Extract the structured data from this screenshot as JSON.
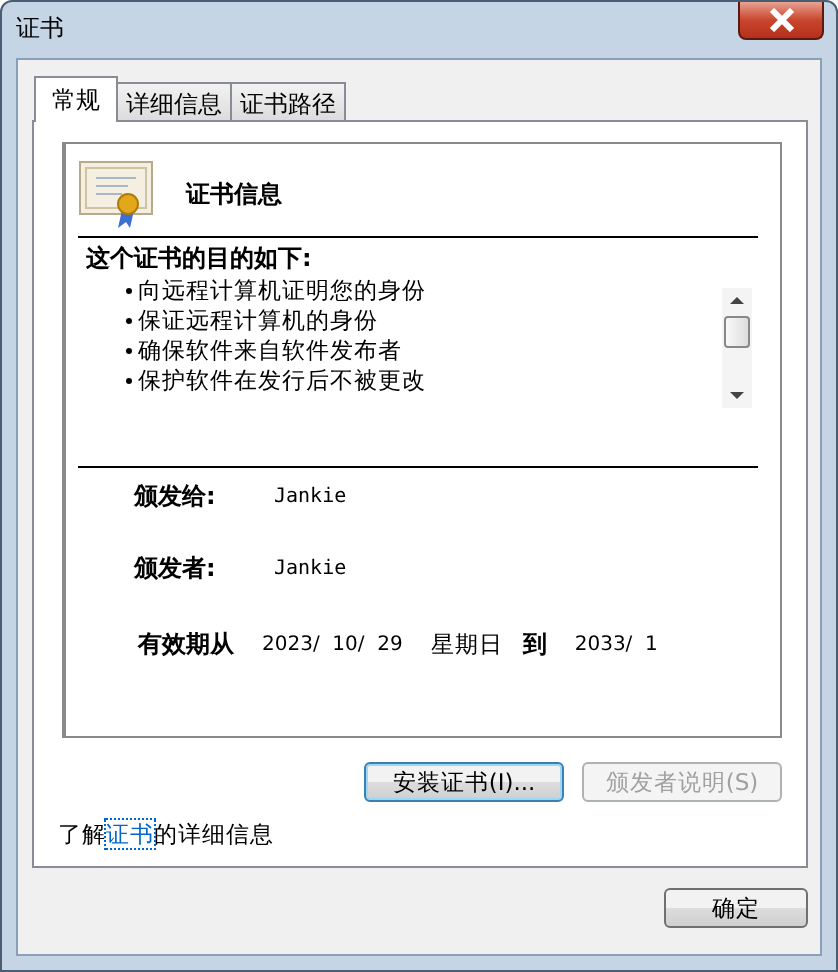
{
  "window": {
    "title": "证书"
  },
  "tabs": [
    {
      "label": "常规",
      "selected": true
    },
    {
      "label": "详细信息",
      "selected": false
    },
    {
      "label": "证书路径",
      "selected": false
    }
  ],
  "info": {
    "heading": "证书信息",
    "purpose_heading": "这个证书的目的如下:",
    "purposes": [
      "向远程计算机证明您的身份",
      "保证远程计算机的身份",
      "确保软件来自软件发布者",
      "保护软件在发行后不被更改"
    ],
    "issued_to_label": "颁发给:",
    "issued_to": "Jankie",
    "issued_by_label": "颁发者:",
    "issued_by": "Jankie",
    "valid_from_label": "有效期从",
    "valid_from": "2023/  10/  29",
    "weekday": "星期日",
    "valid_to_label": "到",
    "valid_to": "2033/  1"
  },
  "buttons": [
    {
      "label": "安装证书(I)...",
      "disabled": false
    },
    {
      "label": "颁发者说明(S)",
      "disabled": true
    }
  ],
  "learn_more": {
    "before": "了解",
    "link": "证书",
    "after": "的详细信息"
  },
  "footer_buttons": [
    {
      "label": "确定",
      "disabled": false
    }
  ]
}
